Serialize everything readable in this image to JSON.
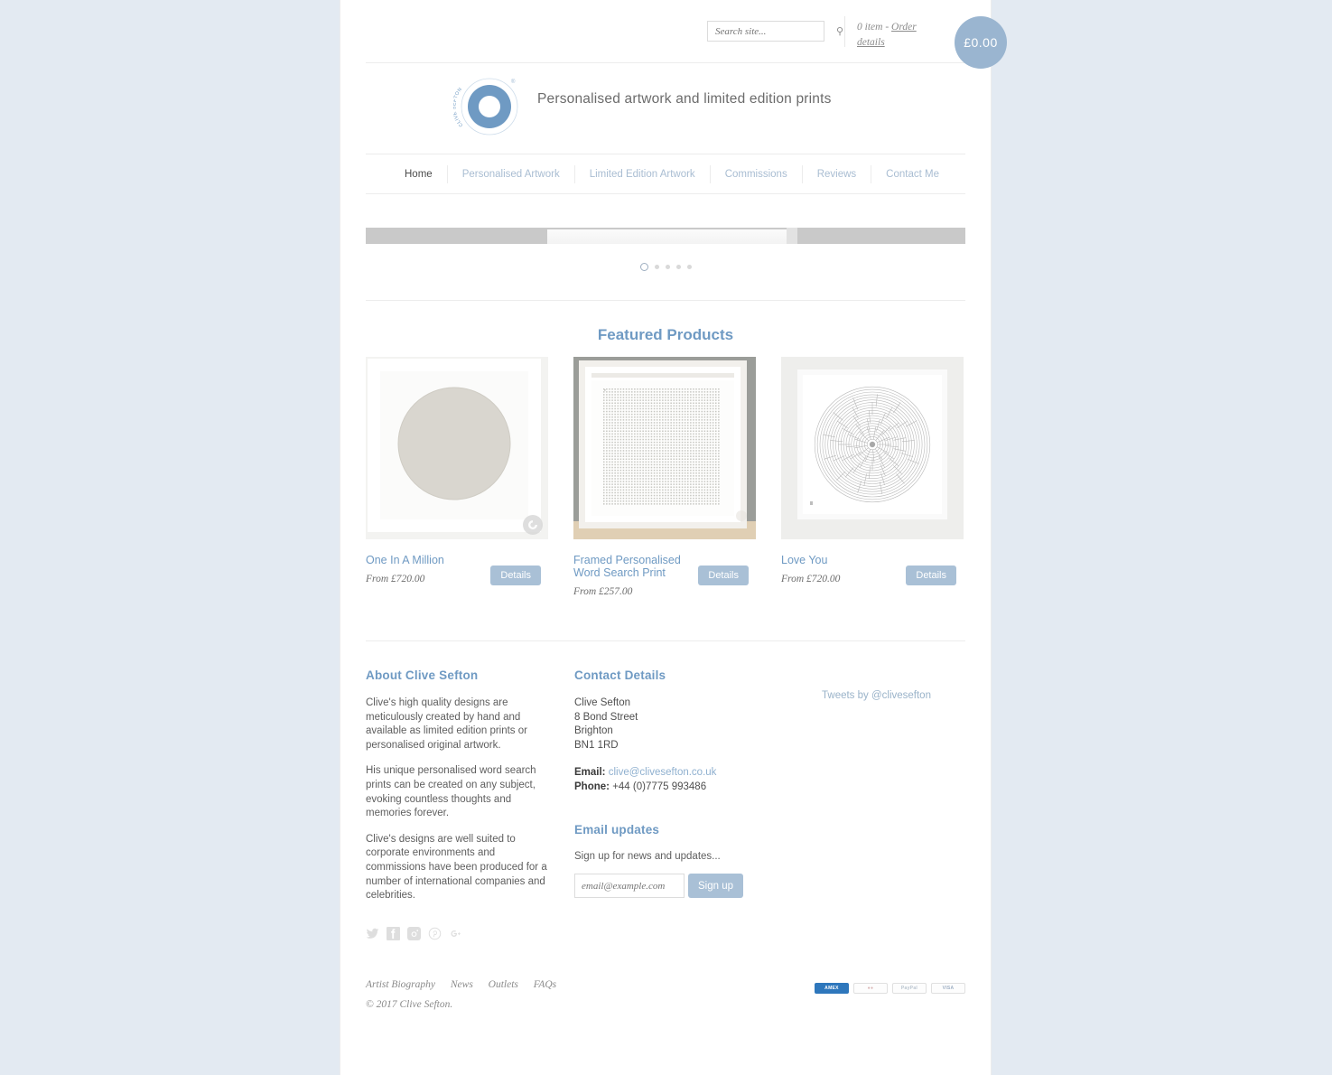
{
  "topbar": {
    "search_placeholder": "Search site...",
    "search_value": "",
    "search_icon": "search-icon",
    "cart_count": "0 item",
    "cart_sep": " - ",
    "order_details": "Order details",
    "basket_total": "£0.00"
  },
  "brand": {
    "logo_text": "CLIVE SEFTON",
    "registered": "®",
    "tagline": "Personalised artwork and limited edition prints"
  },
  "nav": {
    "items": [
      {
        "label": "Home",
        "active": true
      },
      {
        "label": "Personalised Artwork",
        "active": false
      },
      {
        "label": "Limited Edition Artwork",
        "active": false
      },
      {
        "label": "Commissions",
        "active": false
      },
      {
        "label": "Reviews",
        "active": false
      },
      {
        "label": "Contact Me",
        "active": false
      }
    ]
  },
  "slider": {
    "dot_count": 5,
    "active_dot": 1
  },
  "featured": {
    "heading": "Featured Products",
    "details_label": "Details",
    "products": [
      {
        "name": "One In A Million",
        "price": "From £720.00",
        "art": "circle-disc"
      },
      {
        "name": "Framed Personalised Word Search Print",
        "price": "From £257.00",
        "art": "word-search-grid"
      },
      {
        "name": "Love You",
        "price": "From £720.00",
        "art": "circle-maze"
      }
    ]
  },
  "about": {
    "heading": "About Clive Sefton",
    "paragraphs": [
      "Clive's high quality designs are meticulously created by hand and available as limited edition prints or personalised original artwork.",
      "His unique personalised word search prints can be created on any subject, evoking countless thoughts and memories forever.",
      "Clive's designs are well suited to corporate environments and commissions have been produced for a number of international companies and celebrities."
    ],
    "socials": [
      {
        "name": "twitter-icon",
        "glyph": "\u0000"
      },
      {
        "name": "facebook-icon",
        "glyph": "\u0000"
      },
      {
        "name": "instagram-icon",
        "glyph": "\u0000"
      },
      {
        "name": "pinterest-icon",
        "glyph": "\u0000"
      },
      {
        "name": "google-plus-icon",
        "glyph": "\u0000"
      }
    ]
  },
  "contact": {
    "heading": "Contact Details",
    "name": "Clive Sefton",
    "street": "8 Bond Street",
    "city": "Brighton",
    "postcode": "BN1 1RD",
    "email_label": "Email:",
    "email": "clive@clivesefton.co.uk",
    "phone_label": "Phone:",
    "phone": "+44 (0)7775 993486"
  },
  "email_updates": {
    "heading": "Email updates",
    "description": "Sign up for news and updates...",
    "input_placeholder": "email@example.com",
    "input_value": "",
    "button_label": "Sign up"
  },
  "twitter": {
    "link": "Tweets by @clivesefton"
  },
  "footer": {
    "links": [
      "Artist Biography",
      "News",
      "Outlets",
      "FAQs"
    ],
    "copyright": "© 2017 Clive Sefton.",
    "payments": [
      {
        "name": "amex",
        "label": "AMERICAN EXPRESS",
        "color": "#2e77bc"
      },
      {
        "name": "mastercard",
        "label": "MasterCard",
        "color": "#efefef"
      },
      {
        "name": "paypal",
        "label": "PayPal",
        "color": "#f7f7f7"
      },
      {
        "name": "visa",
        "label": "VISA",
        "color": "#f7f7f7"
      }
    ]
  },
  "colors": {
    "page_bg": "#e3eaf2",
    "accent_blue": "#6f9ac3",
    "button_blue": "#a9c0d6",
    "basket_blue": "#9ab5d0"
  }
}
